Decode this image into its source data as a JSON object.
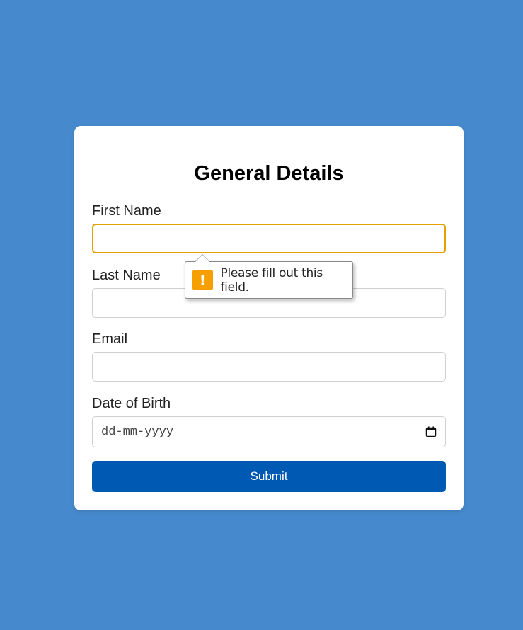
{
  "form": {
    "title": "General Details",
    "fields": [
      {
        "label": "First Name",
        "value": "",
        "placeholder": ""
      },
      {
        "label": "Last Name",
        "value": "",
        "placeholder": ""
      },
      {
        "label": "Email",
        "value": "",
        "placeholder": ""
      },
      {
        "label": "Date of Birth",
        "placeholder": "dd-mm-yyyy",
        "icon": "calendar-icon"
      }
    ],
    "submit_label": "Submit"
  },
  "validation": {
    "message": "Please fill out this field.",
    "icon": "warning-icon",
    "icon_symbol": "!"
  },
  "colors": {
    "background": "#4689cd",
    "focus_border": "#e5a100",
    "submit_button": "#0059b3",
    "warning": "#f59f00"
  }
}
